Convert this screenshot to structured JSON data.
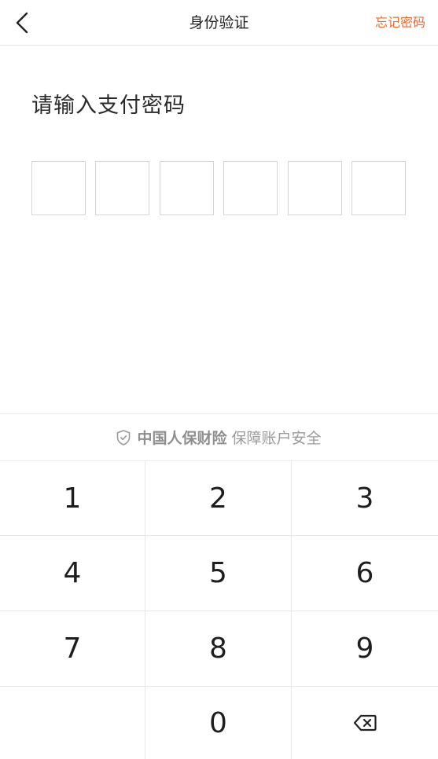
{
  "header": {
    "title": "身份验证",
    "forgot_label": "忘记密码",
    "accent_color": "#f2652b"
  },
  "prompt": "请输入支付密码",
  "pin": {
    "length": 6,
    "entered": 0
  },
  "security": {
    "icon": "shield-check-icon",
    "brand": "中国人保财险",
    "text": "保障账户安全"
  },
  "keypad": {
    "keys": [
      "1",
      "2",
      "3",
      "4",
      "5",
      "6",
      "7",
      "8",
      "9",
      "",
      "0",
      "backspace"
    ],
    "backspace_icon": "backspace-icon"
  }
}
